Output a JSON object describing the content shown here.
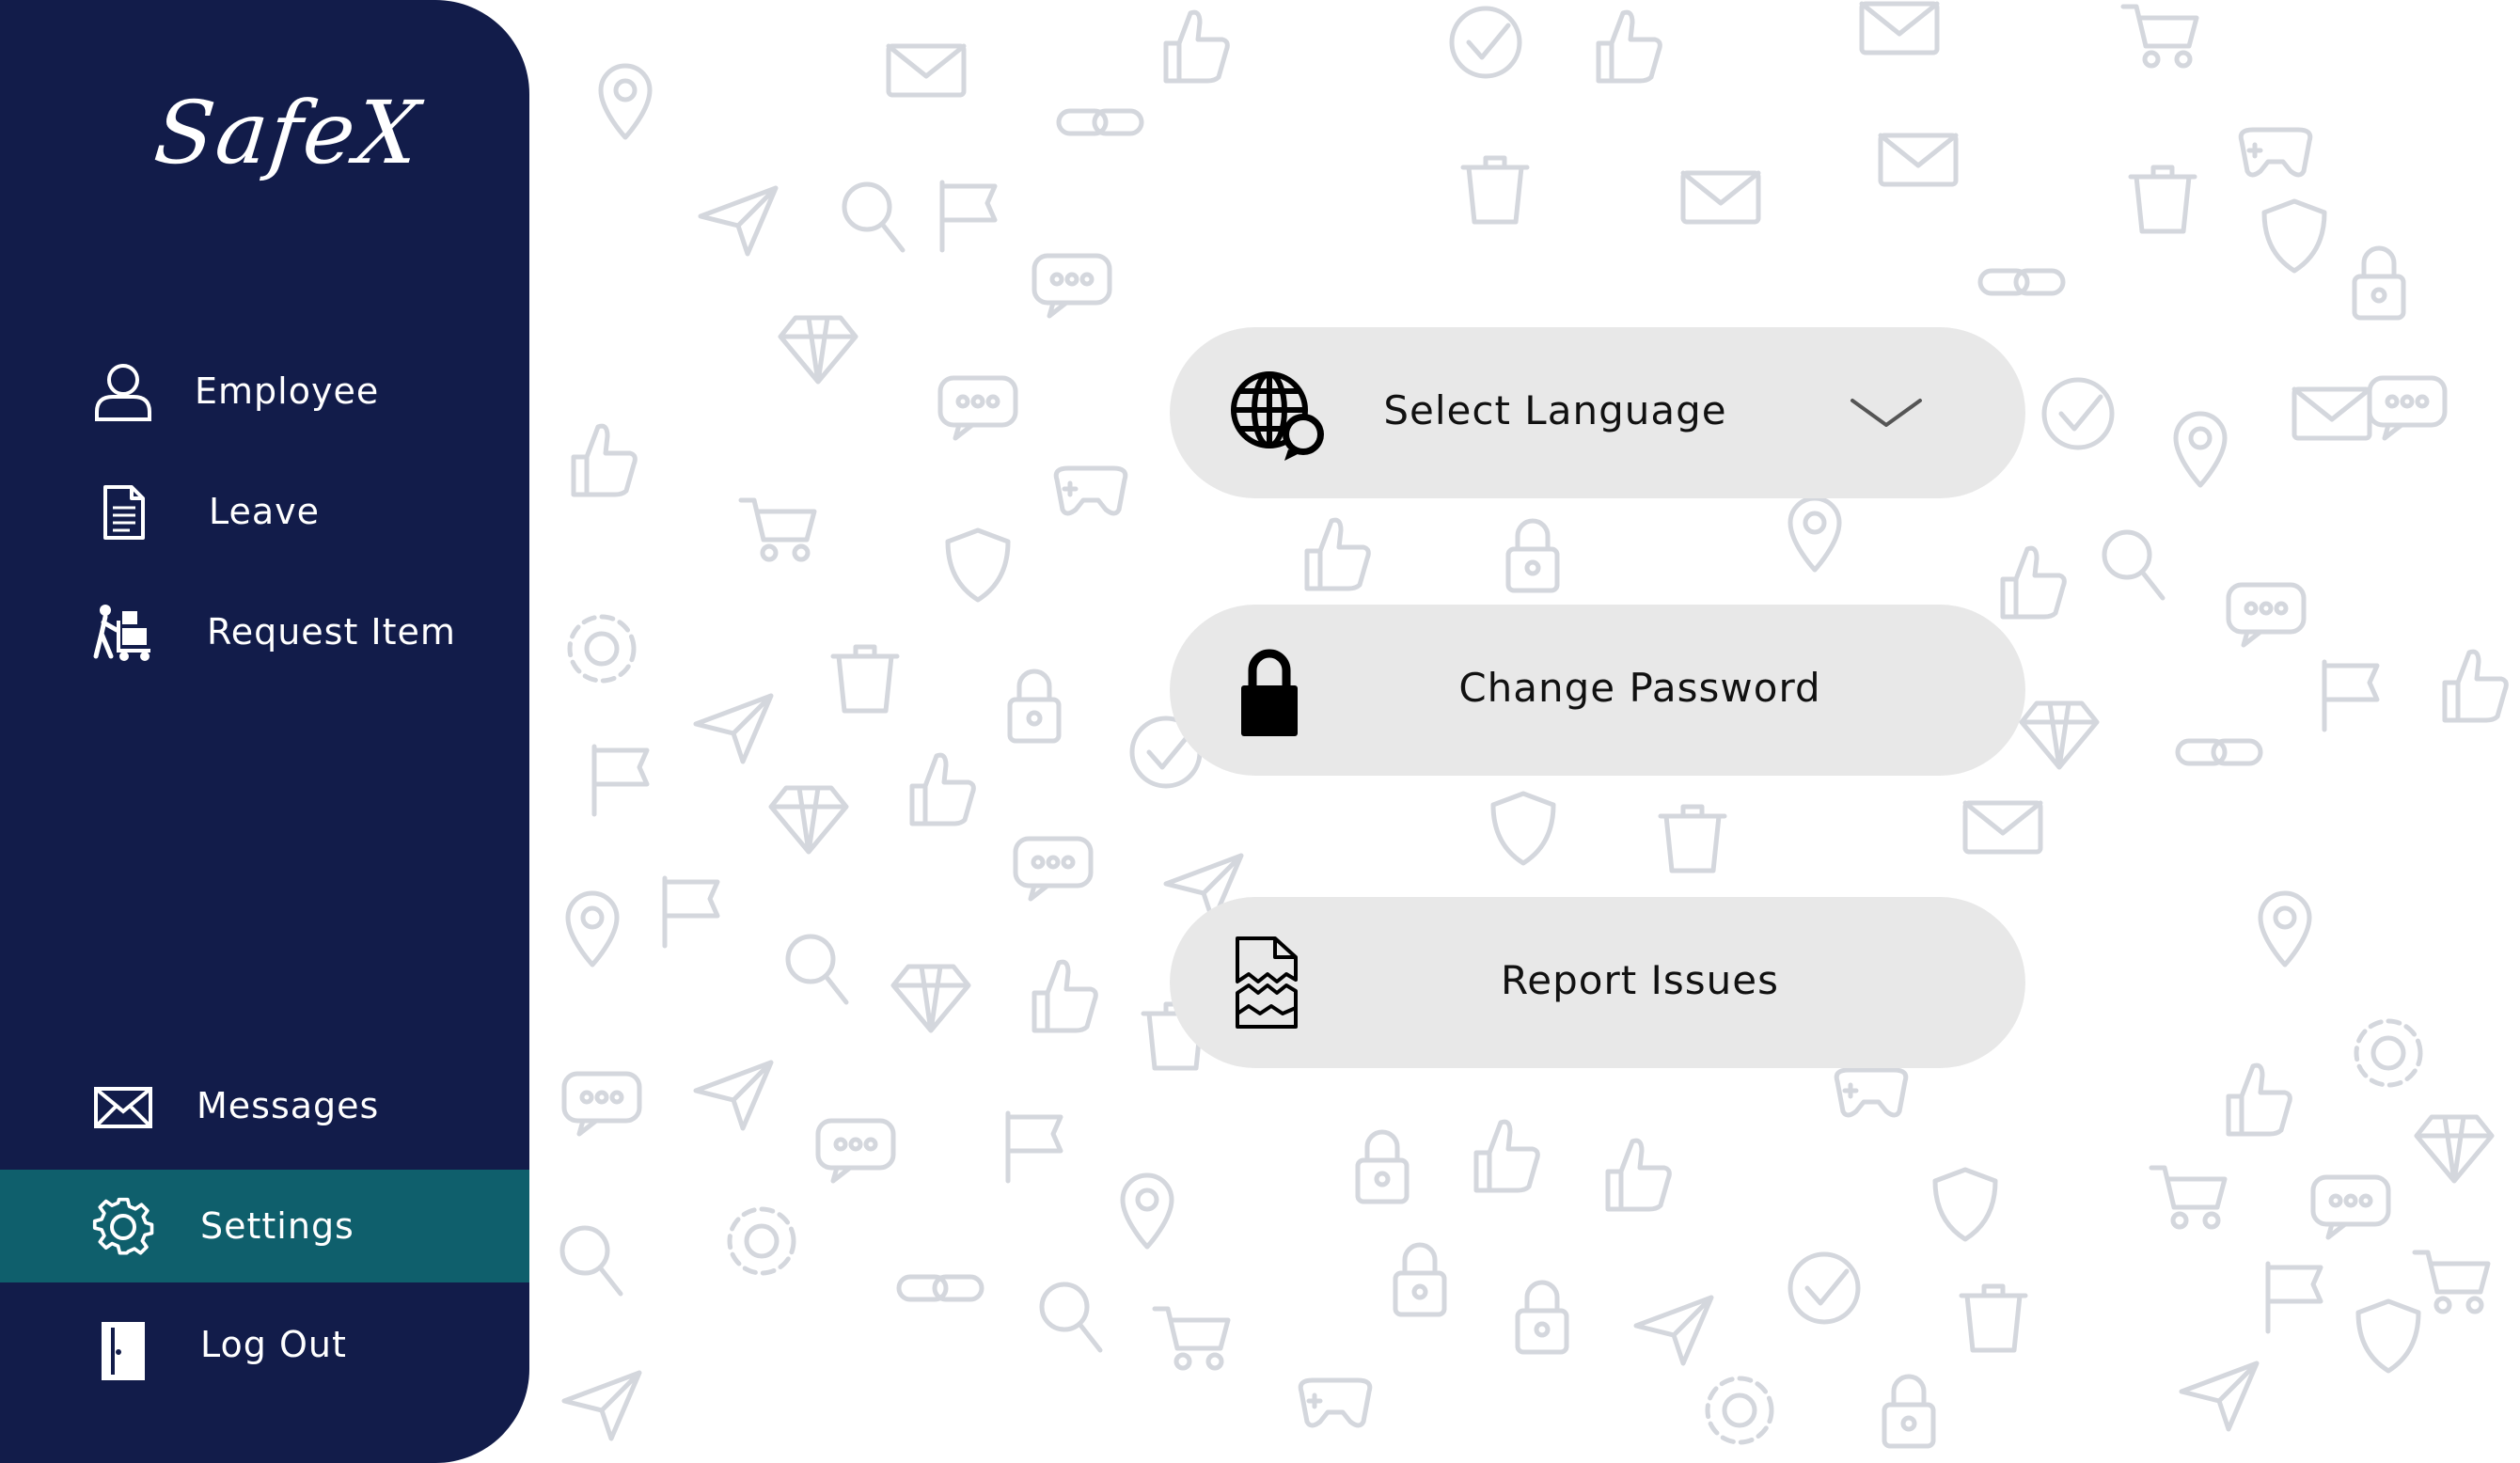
{
  "app": {
    "logo_text": "SafeX"
  },
  "sidebar": {
    "items": [
      {
        "label": "Employee",
        "icon": "user-icon"
      },
      {
        "label": "Leave",
        "icon": "document-icon"
      },
      {
        "label": "Request Item",
        "icon": "trolley-icon"
      },
      {
        "label": "Messages",
        "icon": "envelope-icon"
      },
      {
        "label": "Settings",
        "icon": "gear-icon",
        "active": true
      },
      {
        "label": "Log Out",
        "icon": "door-icon"
      }
    ]
  },
  "settings": {
    "language": {
      "label": "Select Language",
      "icon": "globe-chat-icon",
      "dropdown_icon": "chevron-down-icon"
    },
    "password": {
      "label": "Change Password",
      "icon": "lock-icon"
    },
    "report": {
      "label": "Report Issues",
      "icon": "broken-document-icon"
    }
  },
  "colors": {
    "sidebar_bg": "#121c4a",
    "active_item_bg": "#0f5f6c",
    "card_bg": "#e8e8e8",
    "doodle_stroke": "#d4d7dd"
  }
}
